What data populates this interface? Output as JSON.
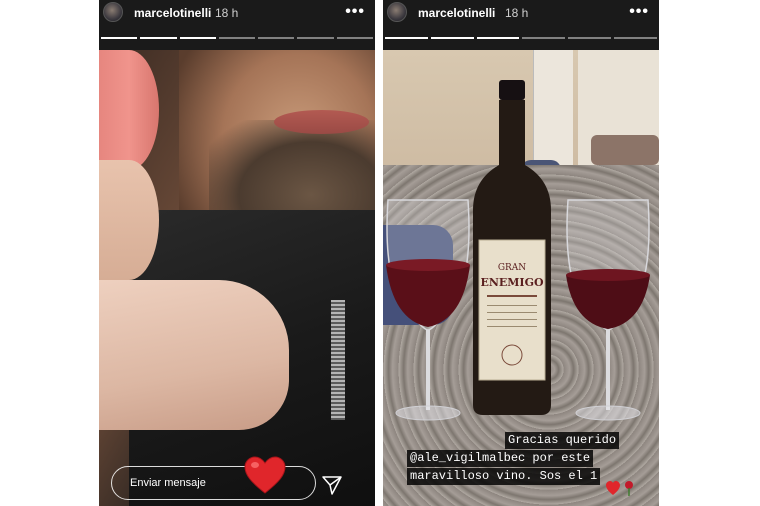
{
  "left_story": {
    "username": "marcelotinelli",
    "time": "18 h",
    "menu_glyph": "•••",
    "progress": {
      "segments": 7,
      "active_index": 2
    },
    "reply_placeholder": "Enviar mensaje",
    "heart_icon": "heart-icon",
    "send_icon": "send-icon"
  },
  "right_story": {
    "username": "marcelotinelli",
    "time": "18 h",
    "menu_glyph": "•••",
    "progress": {
      "segments": 6,
      "active_index": 2
    },
    "caption": {
      "line1": "Gracias querido",
      "line2": "@ale_vigilmalbec  por este",
      "line3": "maravilloso vino. Sos el 1"
    },
    "sticker": "heart-rose-sticker"
  },
  "colors": {
    "topbar": "#1a1a1a",
    "heart_red": "#e0262b",
    "wine": "#5a0f18"
  }
}
